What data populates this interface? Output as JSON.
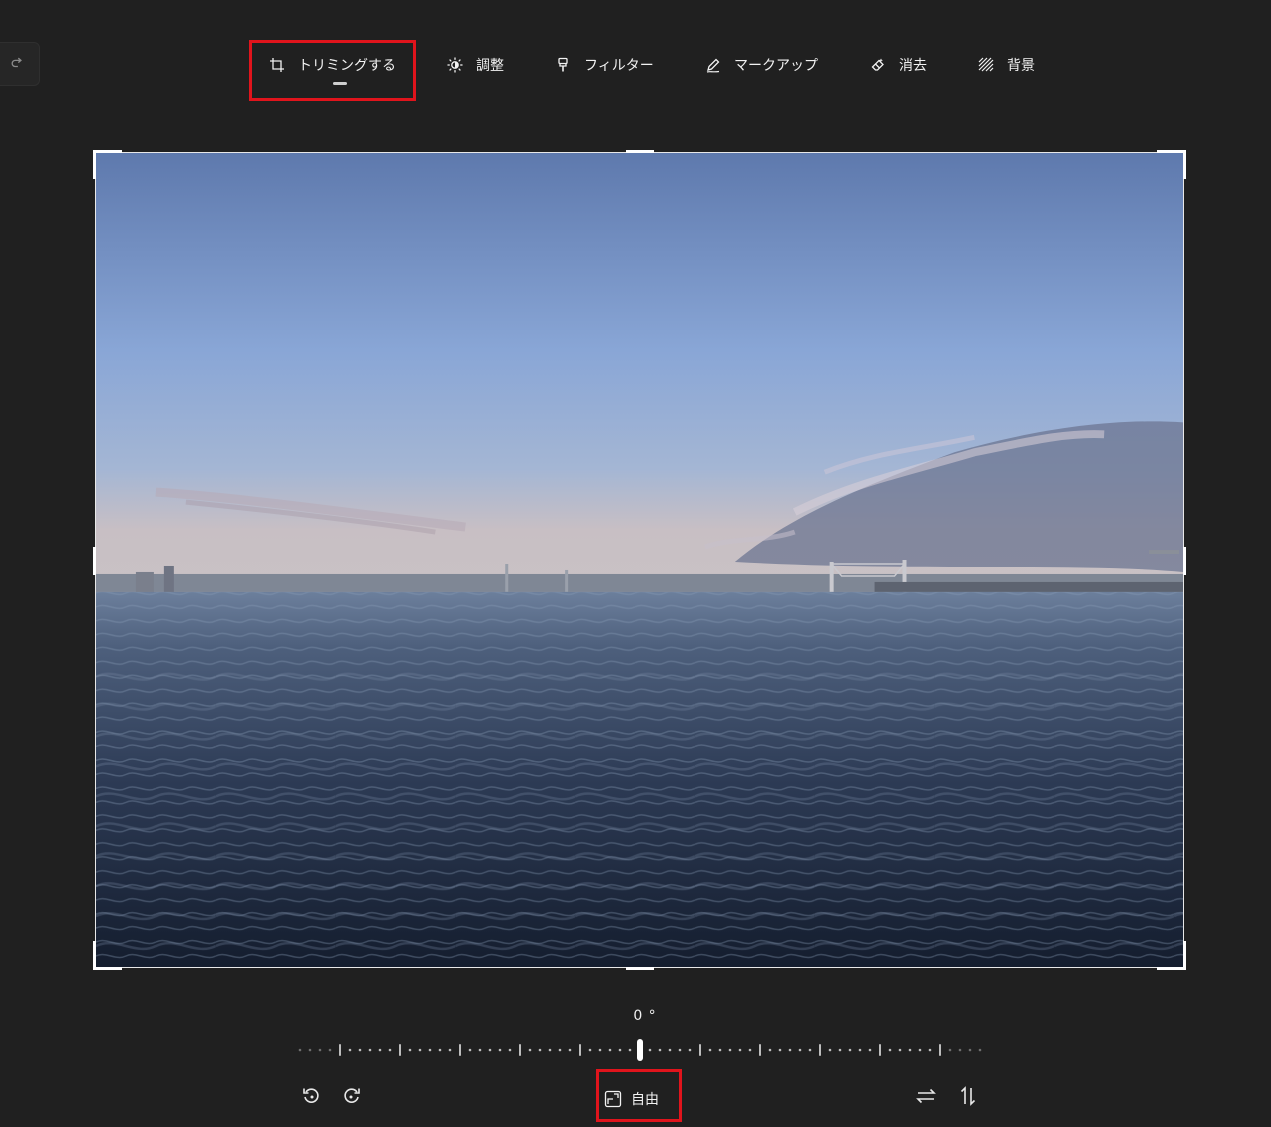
{
  "toolbar": {
    "items": [
      {
        "label": "トリミングする",
        "icon": "crop-icon"
      },
      {
        "label": "調整",
        "icon": "brightness-icon"
      },
      {
        "label": "フィルター",
        "icon": "filter-icon"
      },
      {
        "label": "マークアップ",
        "icon": "markup-pen-icon"
      },
      {
        "label": "消去",
        "icon": "eraser-icon"
      },
      {
        "label": "背景",
        "icon": "background-icon"
      }
    ],
    "active_index": 0
  },
  "left": {
    "redo_icon": "redo-icon"
  },
  "rotation": {
    "angle_text": "0 °",
    "angle_value": 0
  },
  "bottom": {
    "rotate_left_icon": "rotate-left-icon",
    "rotate_right_icon": "rotate-right-icon",
    "aspect_ratio_label": "自由",
    "aspect_ratio_icon": "aspect-ratio-icon",
    "flip_horizontal_icon": "flip-horizontal-icon",
    "flip_vertical_icon": "flip-vertical-icon"
  },
  "colors": {
    "background": "#202020",
    "highlight": "#e0141c",
    "crop_border": "#ffffff"
  }
}
